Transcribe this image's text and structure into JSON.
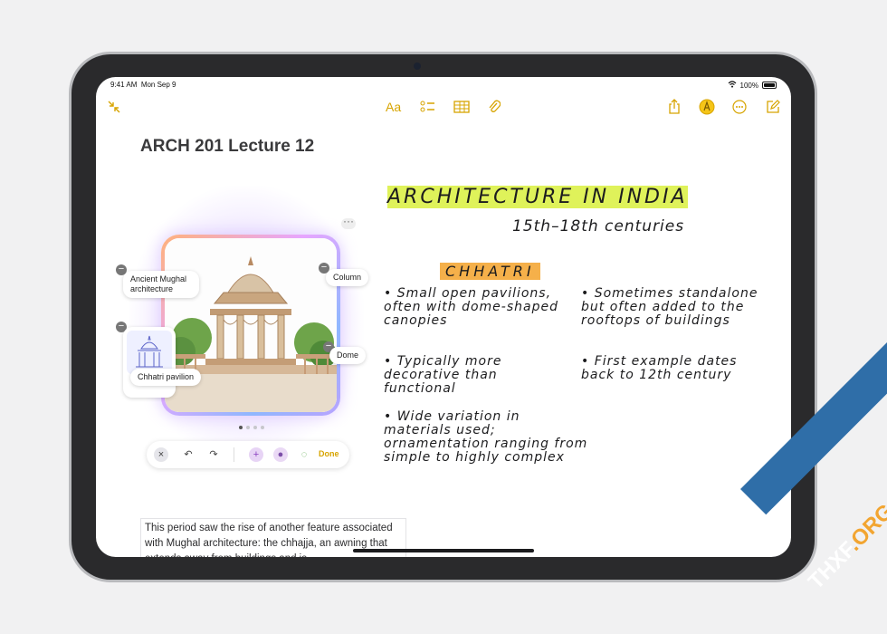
{
  "status": {
    "time": "9:41 AM",
    "date": "Mon Sep 9",
    "battery": "100%"
  },
  "toolbar": {
    "collapse_icon": "arrows-collapse-icon",
    "format_label": "Aa",
    "checklist_icon": "checklist-icon",
    "table_icon": "table-icon",
    "attachment_icon": "paperclip-icon",
    "share_icon": "share-icon",
    "markup_icon": "pencil-tip-icon",
    "more_icon": "ellipsis-icon",
    "compose_icon": "compose-icon"
  },
  "note": {
    "title": "ARCH 201 Lecture 12"
  },
  "image_card": {
    "labels": [
      "Ancient Mughal architecture",
      "Column",
      "Dome",
      "Chhatri pavilion"
    ],
    "more_icon": "ellipsis-icon"
  },
  "image_toolbar": {
    "done_label": "Done"
  },
  "handwriting": {
    "heading": "ARCHITECTURE IN INDIA",
    "subheading": "15th–18th centuries",
    "section": "CHHATRI",
    "bullets_left": [
      "Small open pavilions, often with dome-shaped canopies",
      "Typically more decorative than functional",
      "Wide variation in materials used; ornamentation ranging from simple to highly complex"
    ],
    "bullets_right": [
      "Sometimes standalone but often added to the rooftops of buildings",
      "First example dates back to 12th century"
    ]
  },
  "body_text": "This period saw the rise of another feature associated with Mughal architecture: the chhajja, an awning that extends away from buildings and is",
  "watermark": {
    "prefix": "THXF",
    "suffix": ".ORG"
  },
  "colors": {
    "accent": "#d7a400",
    "highlight_yellow": "#dff25a",
    "highlight_orange": "#f5b04a",
    "highlight_purple": "#c9c4f2"
  }
}
